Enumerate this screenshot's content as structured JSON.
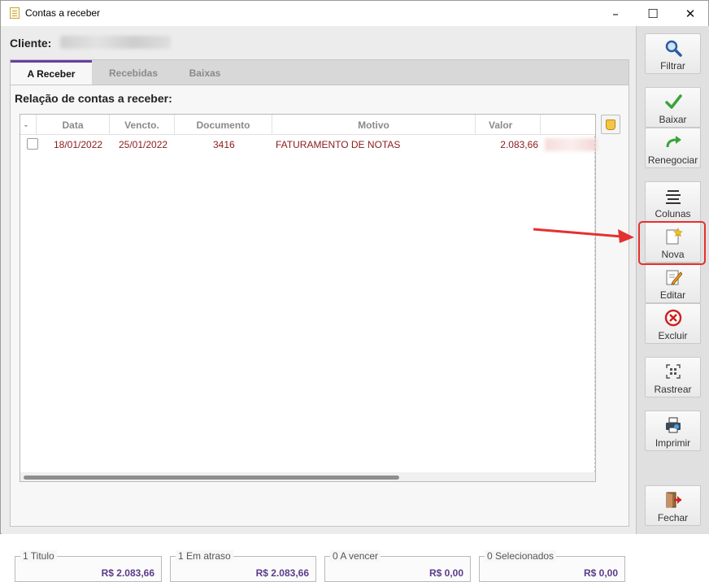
{
  "window": {
    "title": "Contas a receber"
  },
  "client": {
    "label": "Cliente:"
  },
  "tabs": [
    {
      "label": "A Receber"
    },
    {
      "label": "Recebidas"
    },
    {
      "label": "Baixas"
    }
  ],
  "panel": {
    "title": "Relação de contas a receber:"
  },
  "table": {
    "columns": [
      "-",
      "Data",
      "Vencto.",
      "Documento",
      "Motivo",
      "Valor"
    ],
    "rows": [
      {
        "data": "18/01/2022",
        "vencto": "25/01/2022",
        "documento": "3416",
        "motivo": "FATURAMENTO DE NOTAS",
        "valor": "2.083,66"
      }
    ]
  },
  "summary": [
    {
      "label": "1 Titulo",
      "value": "R$ 2.083,66"
    },
    {
      "label": "1 Em atraso",
      "value": "R$ 2.083,66"
    },
    {
      "label": "0 A vencer",
      "value": "R$ 0,00"
    },
    {
      "label": "0 Selecionados",
      "value": "R$ 0,00"
    }
  ],
  "sidebar": {
    "filtrar": "Filtrar",
    "baixar": "Baixar",
    "renegociar": "Renegociar",
    "colunas": "Colunas",
    "nova": "Nova",
    "editar": "Editar",
    "excluir": "Excluir",
    "rastrear": "Rastrear",
    "imprimir": "Imprimir",
    "fechar": "Fechar"
  },
  "colors": {
    "accent": "#6a3fa0",
    "row_text": "#8b1a1a",
    "annotation": "#e53030",
    "total_text": "#5b3b8a"
  }
}
